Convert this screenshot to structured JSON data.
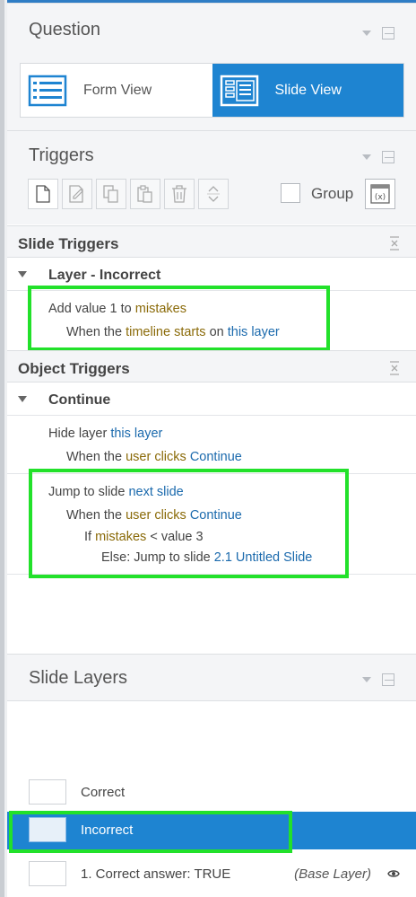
{
  "question_panel": {
    "title": "Question",
    "form_view_label": "Form View",
    "slide_view_label": "Slide View"
  },
  "triggers_panel": {
    "title": "Triggers",
    "group_label": "Group"
  },
  "slide_triggers": {
    "title": "Slide Triggers",
    "group_name": "Layer - Incorrect",
    "trigger": {
      "l1": {
        "a": "Add value ",
        "b": "1",
        "c": " to ",
        "d": "mistakes"
      },
      "l2": {
        "a": "When the ",
        "b": "timeline starts",
        "c": " on ",
        "d": "this layer"
      }
    }
  },
  "object_triggers": {
    "title": "Object Triggers",
    "group_name": "Continue",
    "trigger1": {
      "l1": {
        "a": "Hide layer ",
        "b": "this layer"
      },
      "l2": {
        "a": "When the ",
        "b": "user clicks",
        "c": " ",
        "d": "Continue"
      }
    },
    "trigger2": {
      "l1": {
        "a": "Jump to slide ",
        "b": "next slide"
      },
      "l2": {
        "a": "When the ",
        "b": "user clicks",
        "c": " ",
        "d": "Continue"
      },
      "l3": {
        "a": "If ",
        "b": "mistakes",
        "c": " < value 3"
      },
      "l4": {
        "a": "Else: Jump to slide ",
        "b": "2.1 Untitled Slide"
      }
    }
  },
  "slide_layers": {
    "title": "Slide Layers",
    "layers": [
      {
        "name": "Correct"
      },
      {
        "name": "Incorrect",
        "selected": true
      },
      {
        "name": "1. Correct answer: TRUE",
        "tag": "(Base Layer)"
      }
    ]
  },
  "colors": {
    "accent": "#1e84d1",
    "highlight": "#22e12a",
    "keyword": "#8a6a08",
    "link": "#1b6aad"
  }
}
